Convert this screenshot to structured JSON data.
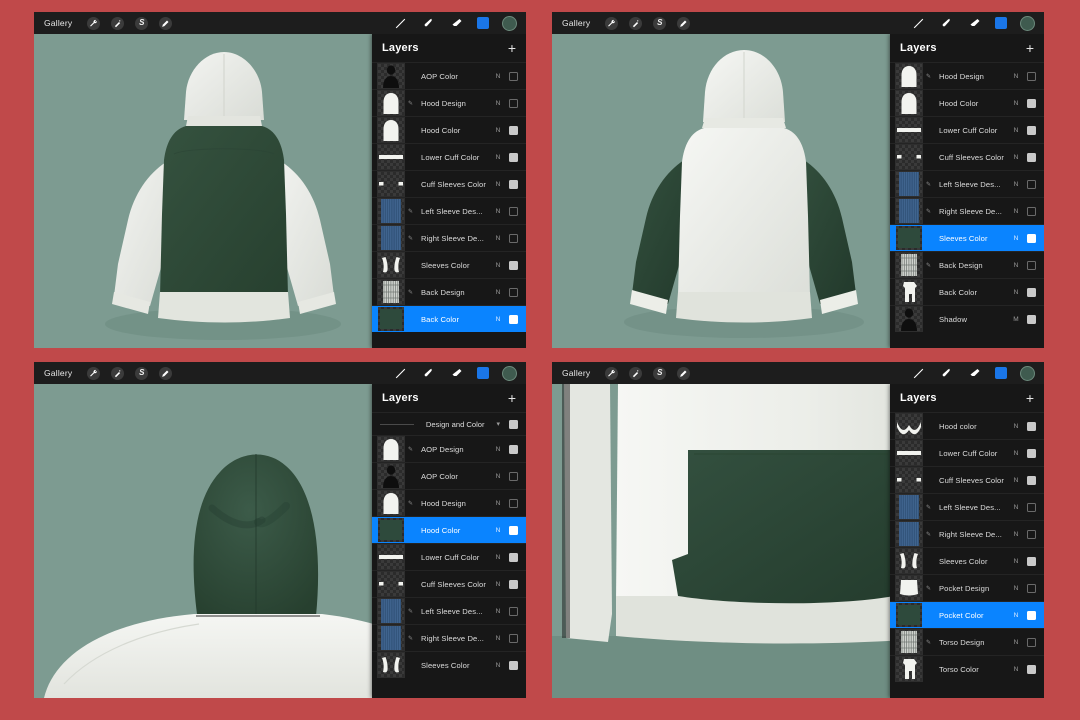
{
  "app": {
    "name": "Procreate",
    "background_color": "#c0494a",
    "canvas_color": "#7d9b91",
    "toolbar_color": "#1d1d1d",
    "accent_color": "#0a84ff",
    "garment_green": "#2e4a3c",
    "garment_white": "#e9eae6"
  },
  "toolbar": {
    "gallery_label": "Gallery",
    "left_icons": [
      "wrench-icon",
      "magic-wand-icon",
      "selection-s-icon",
      "transform-arrow-icon"
    ],
    "right_icons": [
      "brush-icon",
      "smudge-icon",
      "eraser-icon",
      "layers-swatch-icon",
      "color-swatch-icon"
    ],
    "color_swatch": "#3f5b4f",
    "layers_swatch": "#1a76e8"
  },
  "panels": [
    {
      "id": "panel-back-green-body",
      "view": "hoodie-back-green-torso",
      "layers_title": "Layers",
      "add_label": "+",
      "layers": [
        {
          "name": "AOP Color",
          "blend": "N",
          "visible": false,
          "selected": false,
          "locked": false,
          "thumb": "figure-dark"
        },
        {
          "name": "Hood Design",
          "blend": "N",
          "visible": false,
          "selected": false,
          "locked": true,
          "thumb": "hood-white"
        },
        {
          "name": "Hood Color",
          "blend": "N",
          "visible": true,
          "selected": false,
          "locked": false,
          "thumb": "hood-white-solid"
        },
        {
          "name": "Lower Cuff Color",
          "blend": "N",
          "visible": true,
          "selected": false,
          "locked": false,
          "thumb": "band-white"
        },
        {
          "name": "Cuff Sleeves Color",
          "blend": "N",
          "visible": true,
          "selected": false,
          "locked": false,
          "thumb": "cuffs-white"
        },
        {
          "name": "Left Sleeve Des...",
          "blend": "N",
          "visible": false,
          "selected": false,
          "locked": true,
          "thumb": "denim-blue"
        },
        {
          "name": "Right Sleeve De...",
          "blend": "N",
          "visible": false,
          "selected": false,
          "locked": true,
          "thumb": "denim-blue"
        },
        {
          "name": "Sleeves Color",
          "blend": "N",
          "visible": true,
          "selected": false,
          "locked": false,
          "thumb": "sleeves-white"
        },
        {
          "name": "Back Design",
          "blend": "N",
          "visible": false,
          "selected": false,
          "locked": true,
          "thumb": "stripes-grey"
        },
        {
          "name": "Back Color",
          "blend": "N",
          "visible": true,
          "selected": true,
          "locked": false,
          "thumb": "green-patch"
        }
      ]
    },
    {
      "id": "panel-back-green-sleeves",
      "view": "hoodie-back-green-sleeves",
      "layers_title": "Layers",
      "add_label": "+",
      "layers": [
        {
          "name": "Hood Design",
          "blend": "N",
          "visible": false,
          "selected": false,
          "locked": true,
          "thumb": "hood-white"
        },
        {
          "name": "Hood Color",
          "blend": "N",
          "visible": true,
          "selected": false,
          "locked": false,
          "thumb": "hood-white-solid"
        },
        {
          "name": "Lower Cuff Color",
          "blend": "N",
          "visible": true,
          "selected": false,
          "locked": false,
          "thumb": "band-white"
        },
        {
          "name": "Cuff Sleeves Color",
          "blend": "N",
          "visible": true,
          "selected": false,
          "locked": false,
          "thumb": "cuffs-white"
        },
        {
          "name": "Left Sleeve Des...",
          "blend": "N",
          "visible": false,
          "selected": false,
          "locked": true,
          "thumb": "denim-blue"
        },
        {
          "name": "Right Sleeve De...",
          "blend": "N",
          "visible": false,
          "selected": false,
          "locked": true,
          "thumb": "denim-blue"
        },
        {
          "name": "Sleeves Color",
          "blend": "N",
          "visible": true,
          "selected": true,
          "locked": false,
          "thumb": "green-patch"
        },
        {
          "name": "Back Design",
          "blend": "N",
          "visible": false,
          "selected": false,
          "locked": true,
          "thumb": "stripes-grey"
        },
        {
          "name": "Back Color",
          "blend": "N",
          "visible": true,
          "selected": false,
          "locked": false,
          "thumb": "torso-white"
        },
        {
          "name": "Shadow",
          "blend": "M",
          "visible": true,
          "selected": false,
          "locked": false,
          "thumb": "figure-dark"
        }
      ]
    },
    {
      "id": "panel-hood-closeup",
      "view": "hood-closeup-green",
      "layers_title": "Layers",
      "add_label": "+",
      "group": {
        "name": "Design and Color",
        "chevron": "chevron-down-icon",
        "visible": true
      },
      "layers": [
        {
          "name": "AOP  Design",
          "blend": "N",
          "visible": true,
          "selected": false,
          "locked": true,
          "thumb": "hood-white-solid"
        },
        {
          "name": "AOP Color",
          "blend": "N",
          "visible": false,
          "selected": false,
          "locked": false,
          "thumb": "figure-dark"
        },
        {
          "name": "Hood Design",
          "blend": "N",
          "visible": false,
          "selected": false,
          "locked": true,
          "thumb": "hood-white-solid"
        },
        {
          "name": "Hood Color",
          "blend": "N",
          "visible": true,
          "selected": true,
          "locked": false,
          "thumb": "green-patch"
        },
        {
          "name": "Lower Cuff Color",
          "blend": "N",
          "visible": true,
          "selected": false,
          "locked": false,
          "thumb": "band-white"
        },
        {
          "name": "Cuff Sleeves Color",
          "blend": "N",
          "visible": true,
          "selected": false,
          "locked": false,
          "thumb": "cuffs-white"
        },
        {
          "name": "Left Sleeve Des...",
          "blend": "N",
          "visible": false,
          "selected": false,
          "locked": true,
          "thumb": "denim-blue"
        },
        {
          "name": "Right Sleeve De...",
          "blend": "N",
          "visible": false,
          "selected": false,
          "locked": true,
          "thumb": "denim-blue"
        },
        {
          "name": "Sleeves Color",
          "blend": "N",
          "visible": true,
          "selected": false,
          "locked": false,
          "thumb": "sleeves-white"
        }
      ]
    },
    {
      "id": "panel-pocket-closeup",
      "view": "pocket-closeup-green",
      "layers_title": "Layers",
      "add_label": "+",
      "layers": [
        {
          "name": "Hood color",
          "blend": "N",
          "visible": true,
          "selected": false,
          "locked": false,
          "thumb": "hood-arc-white"
        },
        {
          "name": "Lower Cuff Color",
          "blend": "N",
          "visible": true,
          "selected": false,
          "locked": false,
          "thumb": "band-white"
        },
        {
          "name": "Cuff Sleeves Color",
          "blend": "N",
          "visible": true,
          "selected": false,
          "locked": false,
          "thumb": "cuffs-white"
        },
        {
          "name": "Left Sleeve Des...",
          "blend": "N",
          "visible": false,
          "selected": false,
          "locked": true,
          "thumb": "denim-blue"
        },
        {
          "name": "Right Sleeve De...",
          "blend": "N",
          "visible": false,
          "selected": false,
          "locked": true,
          "thumb": "denim-blue"
        },
        {
          "name": "Sleeves Color",
          "blend": "N",
          "visible": true,
          "selected": false,
          "locked": false,
          "thumb": "sleeves-white"
        },
        {
          "name": "Pocket Design",
          "blend": "N",
          "visible": false,
          "selected": false,
          "locked": true,
          "thumb": "pocket-white"
        },
        {
          "name": "Pocket Color",
          "blend": "N",
          "visible": true,
          "selected": true,
          "locked": false,
          "thumb": "green-patch"
        },
        {
          "name": "Torso Design",
          "blend": "N",
          "visible": false,
          "selected": false,
          "locked": true,
          "thumb": "stripes-grey"
        },
        {
          "name": "Torso Color",
          "blend": "N",
          "visible": true,
          "selected": false,
          "locked": false,
          "thumb": "torso-white"
        }
      ]
    }
  ]
}
